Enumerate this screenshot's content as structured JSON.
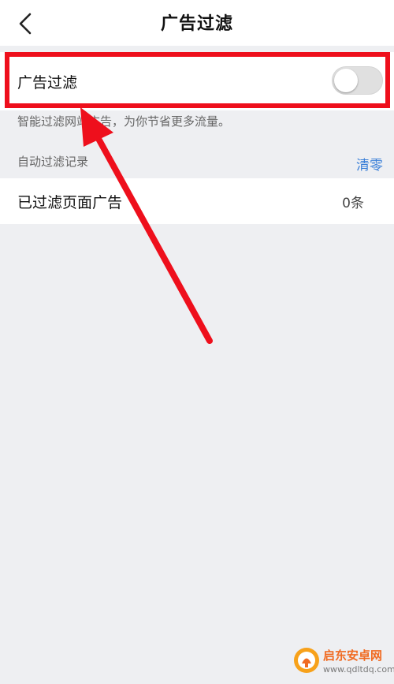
{
  "header": {
    "title": "广告过滤",
    "back_icon": "chevron-left-icon"
  },
  "ad_filter": {
    "label": "广告过滤",
    "enabled": false,
    "description": "智能过滤网站广告，为你节省更多流量。"
  },
  "records": {
    "section_label": "自动过滤记录",
    "clear_label": "清零",
    "items": [
      {
        "label": "已过滤页面广告",
        "count": "0条"
      }
    ]
  },
  "watermark": {
    "name": "启东安卓网",
    "url": "www.qdltdq.com"
  },
  "colors": {
    "accent_blue": "#3a7fd8",
    "annotation_red": "#ee0f1c",
    "background": "#eeeff2"
  }
}
